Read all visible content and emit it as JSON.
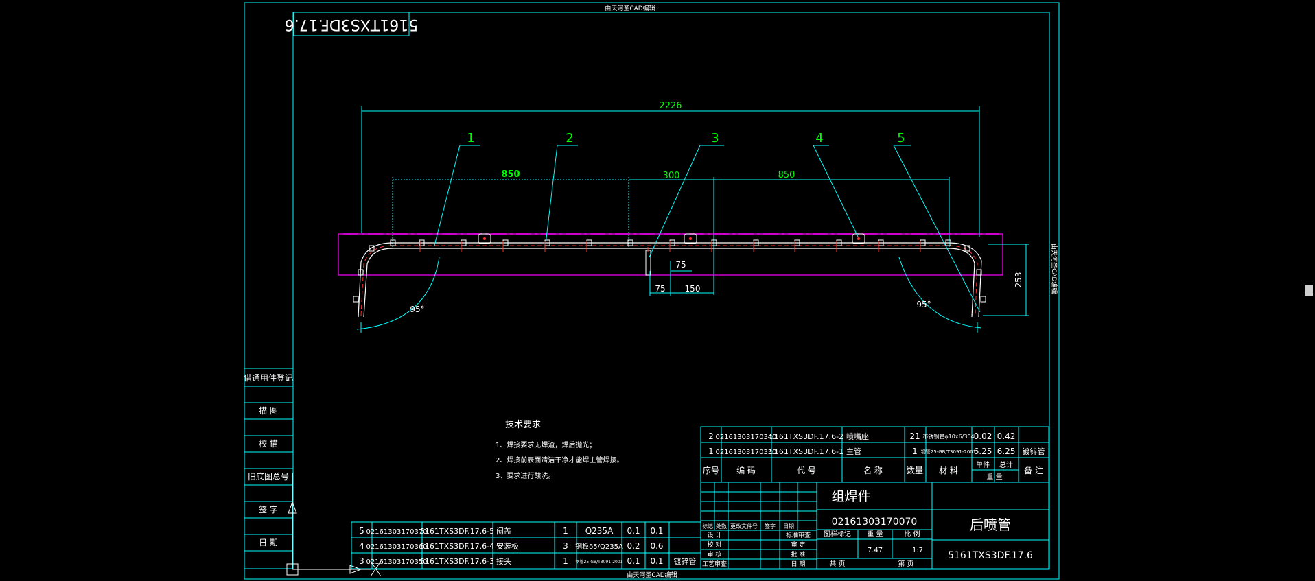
{
  "colors": {
    "background": "#000000",
    "frame": "#00ffff",
    "dimension": "#00ff00",
    "text": "#00ff00",
    "magenta": "#ff00ff",
    "red": "#ff3030",
    "white": "#ffffff"
  },
  "watermark": "由天河圣CAD编辑",
  "drawing_number_mirrored": "5161TXS3DF.17.6",
  "dimensions": {
    "overall_length": "2226",
    "left_span": "850",
    "mid_span": "300",
    "right_span": "850",
    "offset_75_a": "75",
    "offset_75_b": "75",
    "offset_150": "150",
    "height_253": "253",
    "angle_left": "95°",
    "angle_right": "95°"
  },
  "balloons": [
    "1",
    "2",
    "3",
    "4",
    "5"
  ],
  "left_column": {
    "labels": [
      "借通用件登记",
      "描 图",
      "校 描",
      "旧底图总号",
      "签 字",
      "日 期"
    ]
  },
  "tech_requirements": {
    "title": "技术要求",
    "items": [
      "1、焊接要求无焊渣，焊后抛光；",
      "2、焊接前表面清洁干净才能焊主管焊接。",
      "3、要求进行酸洗。"
    ]
  },
  "bom_upper": {
    "rows": [
      {
        "no": "2",
        "code": "02161303170340",
        "ref": "5161TXS3DF.17.6-2",
        "name": "喷嘴座",
        "qty": "21",
        "material": "不锈钢管φ10x6/304",
        "unit_w": "0.02",
        "total_w": "0.42",
        "remark": ""
      },
      {
        "no": "1",
        "code": "02161303170330",
        "ref": "5161TXS3DF.17.6-1",
        "name": "主管",
        "qty": "1",
        "material": "钢管25-GB/T3091-2001",
        "unit_w": "6.25",
        "total_w": "6.25",
        "remark": "镀锌管"
      }
    ],
    "header": {
      "no": "序号",
      "code": "编 码",
      "ref": "代 号",
      "name": "名 称",
      "qty": "数量",
      "material": "材 料",
      "unit": "单件",
      "total": "总计",
      "weight": "重 量",
      "remark": "备 注"
    }
  },
  "bom_lower": {
    "rows": [
      {
        "no": "5",
        "code": "02161303170370",
        "ref": "5161TXS3DF.17.6-5",
        "name": "闷盖",
        "qty": "1",
        "material": "Q235A",
        "unit_w": "0.1",
        "total_w": "0.1",
        "remark": ""
      },
      {
        "no": "4",
        "code": "02161303170360",
        "ref": "5161TXS3DF.17.6-4",
        "name": "安装板",
        "qty": "3",
        "material": "钢板δ5/Q235A",
        "unit_w": "0.2",
        "total_w": "0.6",
        "remark": ""
      },
      {
        "no": "3",
        "code": "02161303170350",
        "ref": "5161TXS3DF.17.6-3",
        "name": "接头",
        "qty": "1",
        "material": "钢管25-GB/T3091-2001",
        "unit_w": "0.1",
        "total_w": "0.1",
        "remark": "镀锌管"
      }
    ]
  },
  "title_block": {
    "assembly_type": "组焊件",
    "part_code": "02161303170070",
    "part_name": "后喷管",
    "drawing_no": "5161TXS3DF.17.6",
    "weight": "7.47",
    "scale": "1:7",
    "stage_label": "图样标记",
    "weight_label": "重 量",
    "scale_label": "比 例",
    "sheet_total": "共 页",
    "sheet_no": "第 页",
    "rev_headers": [
      "标记",
      "处数",
      "更改文件号",
      "签字",
      "日期"
    ],
    "sign_roles": [
      "设 计",
      "校 对",
      "审 核",
      "工艺审查"
    ],
    "approve_roles": [
      "标准审查",
      "审 定",
      "批 准",
      "日 期"
    ]
  }
}
